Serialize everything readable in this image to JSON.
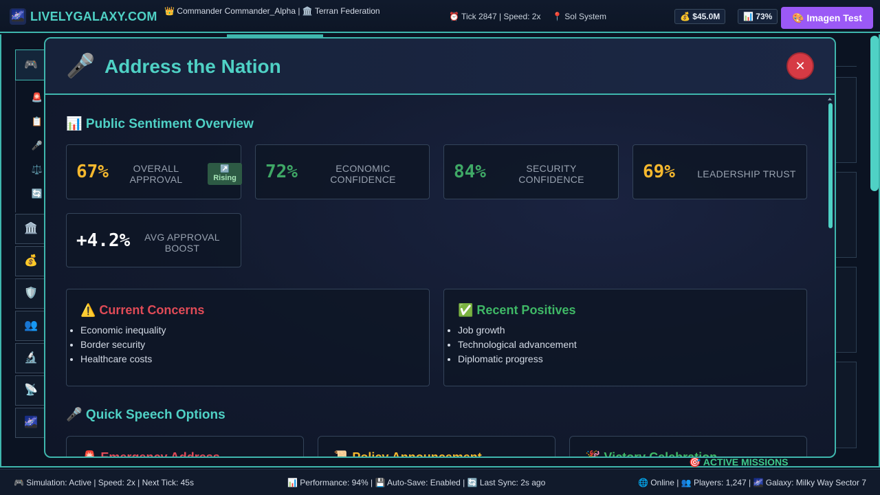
{
  "topbar": {
    "logo_icon": "🌌",
    "logo_text": "LIVELYGALAXY.COM",
    "commander": "👑 Commander Commander_Alpha | 🏛️ Terran Federation",
    "tick": "⏰ Tick 2847 | Speed: 2x",
    "location": "📍 Sol System",
    "money": "💰 $45.0M",
    "percent": "📊 73%",
    "imagen_button": "🎨 Imagen Test"
  },
  "left_rail": {
    "active_icon": "🎮",
    "sub_items": [
      "🚨",
      "📋",
      "🎤",
      "⚖️",
      "🔄"
    ],
    "buttons": [
      "🏛️",
      "💰",
      "🛡️",
      "👥",
      "🔬",
      "📡",
      "🌌"
    ]
  },
  "background": {
    "missions_label": "🎯 ACTIVE MISSIONS"
  },
  "modal": {
    "icon": "🎤",
    "title": "Address the Nation",
    "close_icon": "✕",
    "sentiment_title": "📊 Public Sentiment Overview",
    "stats": [
      {
        "value": "67%",
        "label": "OVERALL APPROVAL",
        "color": "#f5b82e"
      },
      {
        "value": "72%",
        "label": "ECONOMIC CONFIDENCE",
        "color": "#3fa866"
      },
      {
        "value": "84%",
        "label": "SECURITY CONFIDENCE",
        "color": "#3fa866"
      },
      {
        "value": "69%",
        "label": "LEADERSHIP TRUST",
        "color": "#f5b82e"
      },
      {
        "value": "+4.2%",
        "label": "AVG APPROVAL BOOST",
        "color": "#ffffff"
      }
    ],
    "rising_badge": {
      "icon": "↗️",
      "label": "Rising"
    },
    "concerns": {
      "title": "⚠️ Current Concerns",
      "color": "#e04b57",
      "items": [
        "Economic inequality",
        "Border security",
        "Healthcare costs"
      ]
    },
    "positives": {
      "title": "✅ Recent Positives",
      "color": "#3fb866",
      "items": [
        "Job growth",
        "Technological advancement",
        "Diplomatic progress"
      ]
    },
    "quick_speech_title": "🎤 Quick Speech Options",
    "speech_options": [
      {
        "title": "🚨 Emergency Address",
        "color": "#e04b57"
      },
      {
        "title": "📜 Policy Announcement",
        "color": "#f5b82e"
      },
      {
        "title": "🎉 Victory Celebration",
        "color": "#3fb866"
      }
    ]
  },
  "statusbar": {
    "left": "🎮 Simulation: Active | Speed: 2x | Next Tick: 45s",
    "mid": "📊 Performance: 94% | 💾 Auto-Save: Enabled | 🔄 Last Sync: 2s ago",
    "right": "🌐 Online | 👥 Players: 1,247 | 🌌 Galaxy: Milky Way Sector 7"
  }
}
